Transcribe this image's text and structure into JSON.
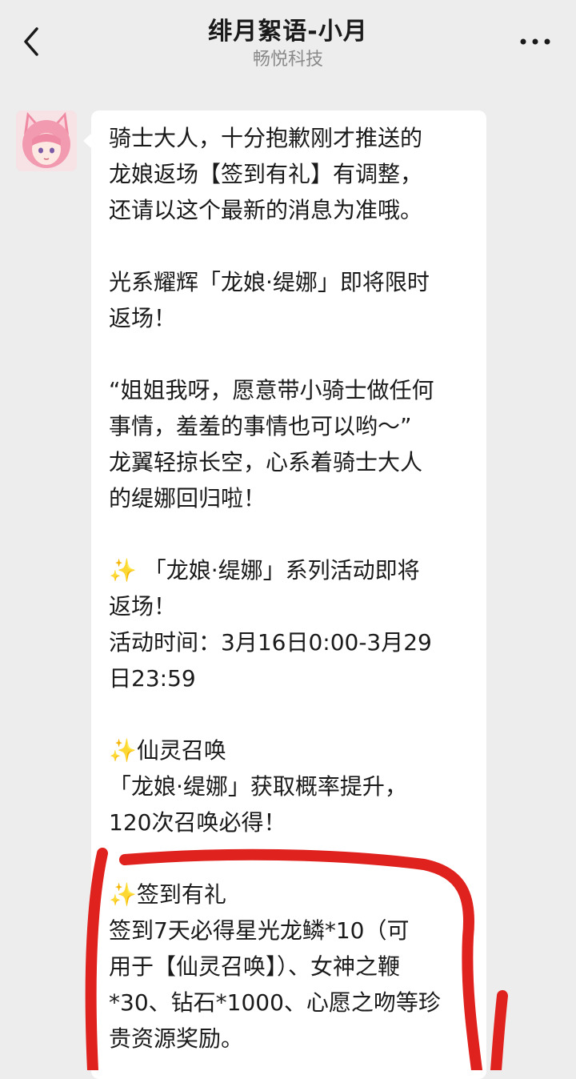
{
  "header": {
    "title": "绯月絮语-小月",
    "subtitle": "畅悦科技",
    "back_icon": "chevron-left-icon",
    "more_icon": "more-dots-icon"
  },
  "message": {
    "avatar_icon": "anime-girl-avatar",
    "sparkle_emoji": "✨",
    "p1": [
      "骑士大人，十分抱歉刚才推送的",
      "龙娘返场【签到有礼】有调整，",
      "还请以这个最新的消息为准哦。"
    ],
    "p2": [
      "光系耀辉「龙娘·缇娜」即将限时",
      "返场！"
    ],
    "p3": [
      "“姐姐我呀，愿意带小骑士做任何",
      "事情，羞羞的事情也可以哟～”",
      "龙翼轻掠长空，心系着骑士大人",
      "的缇娜回归啦！"
    ],
    "p4": [
      " 「龙娘·缇娜」系列活动即将",
      "返场！",
      "活动时间：3月16日0:00-3月29",
      "日23:59"
    ],
    "p5": [
      "仙灵召唤",
      "「龙娘·缇娜」获取概率提升，",
      "120次召唤必得！"
    ],
    "p6": [
      "签到有礼",
      "签到7天必得星光龙鳞*10（可",
      "用于【仙灵召唤】）、女神之鞭",
      "*30、钻石*1000、心愿之吻等珍",
      "贵资源奖励。"
    ]
  },
  "colors": {
    "background": "#ededed",
    "bubble": "#ffffff",
    "text": "#1a1a1a",
    "subtitle": "#8a8a8a",
    "annotation_red": "#e0221e",
    "sparkle": "#f2c230"
  }
}
